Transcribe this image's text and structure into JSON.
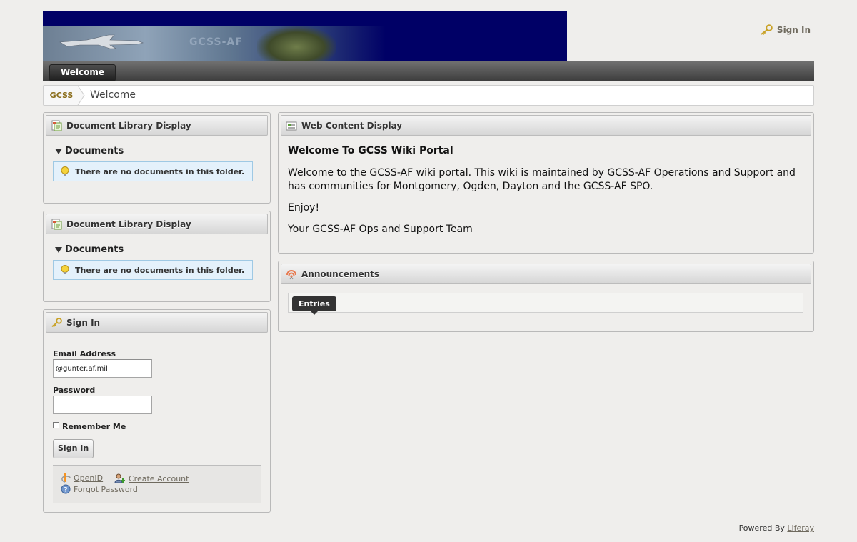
{
  "banner": {
    "title": "GCSS-AF"
  },
  "header": {
    "sign_in_link": "Sign In"
  },
  "nav": {
    "tabs": [
      {
        "label": "Welcome"
      }
    ]
  },
  "breadcrumb": {
    "first": "GCSS",
    "current": "Welcome"
  },
  "doc_library_1": {
    "title": "Document Library Display",
    "section": "Documents",
    "message": "There are no documents in this folder."
  },
  "doc_library_2": {
    "title": "Document Library Display",
    "section": "Documents",
    "message": "There are no documents in this folder."
  },
  "sign_in": {
    "title": "Sign In",
    "email_label": "Email Address",
    "email_value": "@gunter.af.mil",
    "password_label": "Password",
    "password_value": "",
    "remember_label": "Remember Me",
    "submit_label": "Sign In",
    "openid_link": "OpenID",
    "create_account_link": "Create Account",
    "forgot_password_link": "Forgot Password"
  },
  "web_content": {
    "title": "Web Content Display",
    "heading": "Welcome To GCSS Wiki Portal",
    "paragraph": "Welcome to the GCSS-AF wiki portal. This wiki is maintained by GCSS-AF Operations and Support and has communities for Montgomery, Ogden, Dayton and the GCSS-AF SPO.",
    "enjoy": "Enjoy!",
    "signature": "Your GCSS-AF Ops and Support Team"
  },
  "announcements": {
    "title": "Announcements",
    "tab_label": "Entries"
  },
  "footer": {
    "powered_by": "Powered By",
    "link": "Liferay"
  },
  "colors": {
    "banner_bg": "#000066",
    "link": "#6f6a5e",
    "info_bg": "#e4f1fb"
  },
  "icons": [
    "key-icon",
    "document-library-icon",
    "lightbulb-icon",
    "web-content-icon",
    "announcements-icon",
    "openid-icon",
    "create-account-icon",
    "help-icon",
    "breadcrumb-separator-icon"
  ]
}
